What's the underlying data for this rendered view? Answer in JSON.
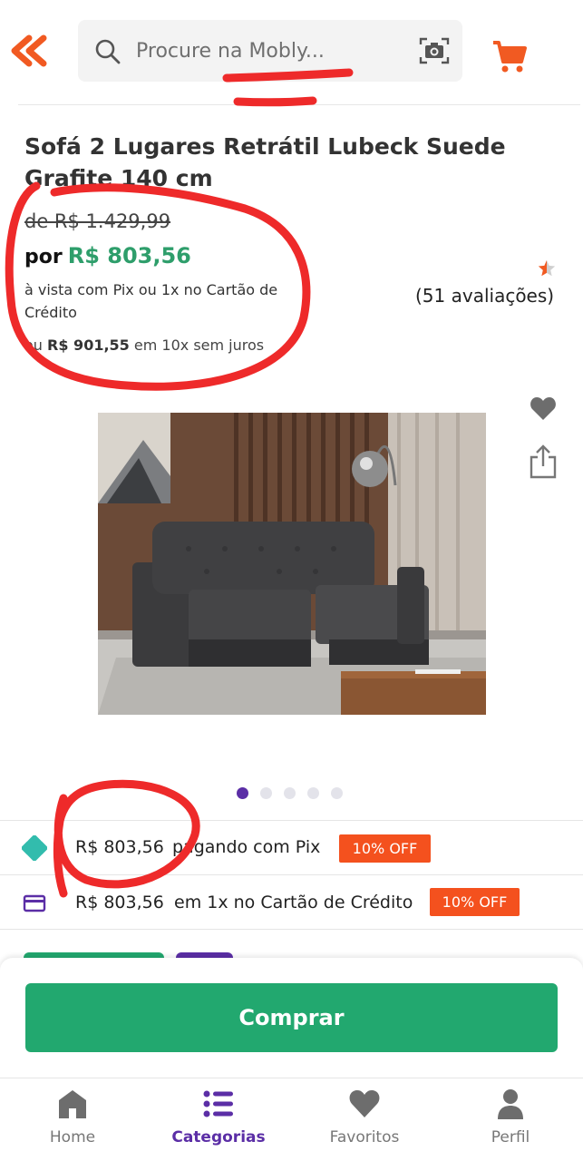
{
  "header": {
    "search_placeholder": "Procure na Mobly..."
  },
  "product": {
    "title": "Sofá 2 Lugares Retrátil Lubeck Suede Grafite 140 cm",
    "old_price": "de R$ 1.429,99",
    "price_prefix": "por",
    "price": "R$ 803,56",
    "price_desc": "à vista com Pix ou 1x no Cartão de Crédito",
    "installments_prefix": "ou",
    "installments_amount": "R$ 901,55",
    "installments_suffix": "em 10x sem juros",
    "rating_count": "(51 avaliações)"
  },
  "gallery": {
    "total_images": 5,
    "active_index": 0
  },
  "payment_options": [
    {
      "amount": "R$ 803,56",
      "label": "pagando com Pix",
      "badge": "10% OFF",
      "icon": "pix-icon"
    },
    {
      "amount": "R$ 803,56",
      "label": "em 1x no Cartão de Crédito",
      "badge": "10% OFF",
      "icon": "credit-card-icon"
    }
  ],
  "buy_button": "Comprar",
  "bottom_nav": [
    {
      "label": "Home",
      "icon": "home-icon",
      "active": false
    },
    {
      "label": "Categorias",
      "icon": "list-icon",
      "active": true
    },
    {
      "label": "Favoritos",
      "icon": "heart-icon",
      "active": false
    },
    {
      "label": "Perfil",
      "icon": "person-icon",
      "active": false
    }
  ],
  "colors": {
    "brand_orange": "#f15a22",
    "price_green": "#2e9e6b",
    "buy_green": "#22a86f",
    "accent_purple": "#5b2ea6",
    "off_badge": "#f4511e",
    "annotation_red": "#ee2a2a"
  }
}
